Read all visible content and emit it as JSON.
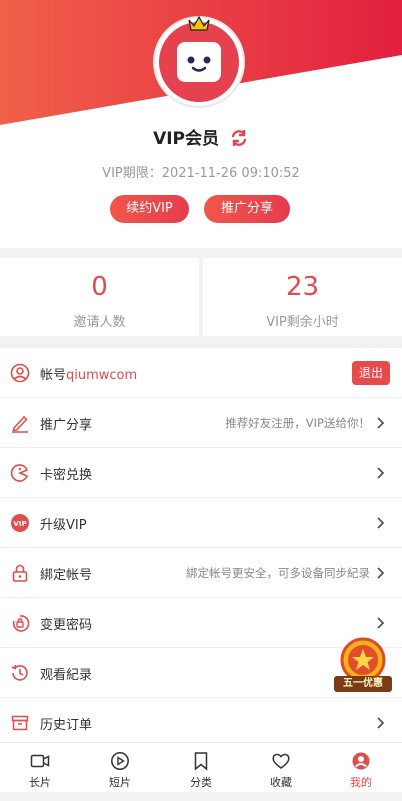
{
  "profile": {
    "title": "VIP会员",
    "expiry": "VIP期限：2021-11-26 09:10:52",
    "renew_label": "续约VIP",
    "share_label": "推广分享"
  },
  "stats": [
    {
      "value": "0",
      "label": "邀请人数"
    },
    {
      "value": "23",
      "label": "VIP剩余小时"
    }
  ],
  "menu": {
    "account_prefix": "帐号",
    "account_name": "qiumwcom",
    "logout_label": "退出",
    "items": [
      {
        "label": "推广分享",
        "hint": "推荐好友注册，VIP送给你！",
        "icon": "edit-share-icon"
      },
      {
        "label": "卡密兑换",
        "hint": "",
        "icon": "card-redeem-icon"
      },
      {
        "label": "升级VIP",
        "hint": "",
        "icon": "vip-badge-icon"
      },
      {
        "label": "綁定帐号",
        "hint": "綁定帐号更安全，可多设备同步紀录",
        "icon": "lock-icon"
      },
      {
        "label": "变更密码",
        "hint": "",
        "icon": "password-lock-icon"
      },
      {
        "label": "观看紀录",
        "hint": "",
        "icon": "history-icon"
      },
      {
        "label": "历史订单",
        "hint": "",
        "icon": "order-box-icon"
      }
    ]
  },
  "promo": {
    "label": "五一优惠"
  },
  "tabs": [
    {
      "label": "长片",
      "icon": "video-icon"
    },
    {
      "label": "短片",
      "icon": "play-circle-icon"
    },
    {
      "label": "分类",
      "icon": "bookmark-icon"
    },
    {
      "label": "收藏",
      "icon": "heart-icon"
    },
    {
      "label": "我的",
      "icon": "user-icon",
      "active": true
    }
  ],
  "colors": {
    "accent": "#e14c4c",
    "header_red": "#e8334a",
    "header_orange": "#f0584a"
  }
}
